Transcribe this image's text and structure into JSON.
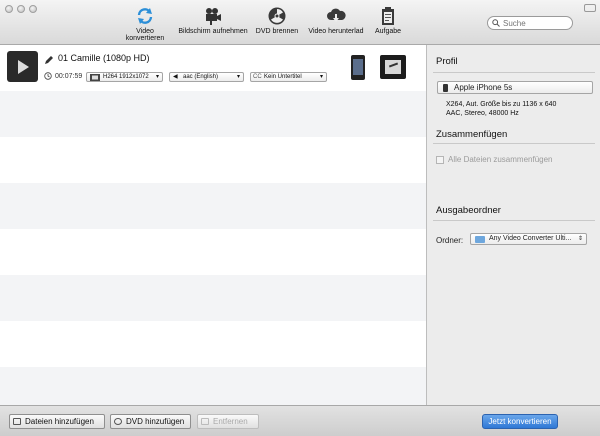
{
  "toolbar": {
    "items": [
      {
        "label": "Video konvertieren",
        "icon": "convert-icon"
      },
      {
        "label": "Bildschirm aufnehmen",
        "icon": "camera-icon"
      },
      {
        "label": "DVD brennen",
        "icon": "dvd-burn-icon"
      },
      {
        "label": "Video herunterlad",
        "icon": "cloud-download-icon"
      },
      {
        "label": "Aufgabe",
        "icon": "clipboard-icon"
      }
    ],
    "search_placeholder": "Suche"
  },
  "file": {
    "name": "01 Camille (1080p HD)",
    "duration": "00:07:59",
    "video_track": "H264 1912x1072",
    "audio_track": "aac (English)",
    "subtitle": "Kein Untertitel"
  },
  "side": {
    "profile_heading": "Profil",
    "profile_value": "Apple iPhone 5s",
    "spec_line1": "X264, Aut. Größe bis zu 1136 x 640",
    "spec_line2": "AAC, Stereo, 48000 Hz",
    "merge_heading": "Zusammenfügen",
    "merge_checkbox": "Alle Dateien zusammenfügen",
    "output_heading": "Ausgabeordner",
    "folder_label": "Ordner:",
    "folder_value": "Any Video Converter Ulti..."
  },
  "bottom": {
    "add_files": "Dateien hinzufügen",
    "add_dvd": "DVD hinzufügen",
    "remove": "Entfernen",
    "convert": "Jetzt konvertieren"
  },
  "colors": {
    "accent": "#2f78d6",
    "convert_icon": "#2c8fd8"
  }
}
